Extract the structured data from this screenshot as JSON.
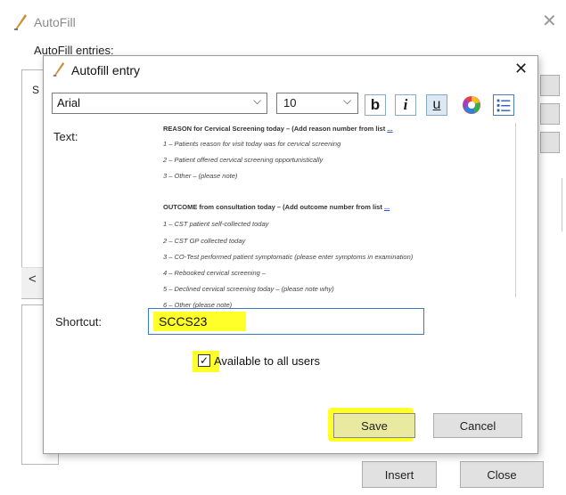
{
  "back_window": {
    "title": "AutoFill",
    "entries_label": "AutoFill entries:",
    "list_visible_text": "S",
    "insert_label": "Insert",
    "close_label": "Close"
  },
  "dialog": {
    "title": "Autofill entry",
    "toolbar": {
      "font": "Arial",
      "size": "10",
      "bold": "b",
      "italic": "i",
      "underline": "u"
    },
    "text_label": "Text:",
    "text_lines": [
      {
        "t": "REASON for Cervical Screening today – (Add reason number from list ",
        "link": "...",
        "bold": true
      },
      {
        "t": "1 – Patients reason for visit today was for cervical screening",
        "bold": false
      },
      {
        "t": "2 – Patient offered cervical screening opportunistically",
        "bold": false
      },
      {
        "t": "3 – Other – (please note)",
        "bold": false
      },
      {
        "t": "OUTCOME from consultation today – (Add outcome number from list ",
        "link": "...",
        "bold": true
      },
      {
        "t": "1 – CST patient self-collected today",
        "bold": false
      },
      {
        "t": "2 – CST GP collected today",
        "bold": false
      },
      {
        "t": "3 – CO-Test performed patient symptomatic (please enter symptoms in examination)",
        "bold": false
      },
      {
        "t": "4 – Rebooked cervical screening –",
        "bold": false
      },
      {
        "t": "5 – Declined cervical screening today – (please note why)",
        "bold": false
      },
      {
        "t": "6 – Other (please note)",
        "bold": false
      }
    ],
    "shortcut_label": "Shortcut:",
    "shortcut_value": "SCCS23",
    "available_label": "Available to all users",
    "available_checked": true,
    "save_label": "Save",
    "cancel_label": "Cancel"
  },
  "colors": {
    "highlight": "#ffff2a",
    "focus_border": "#3a78c8"
  }
}
